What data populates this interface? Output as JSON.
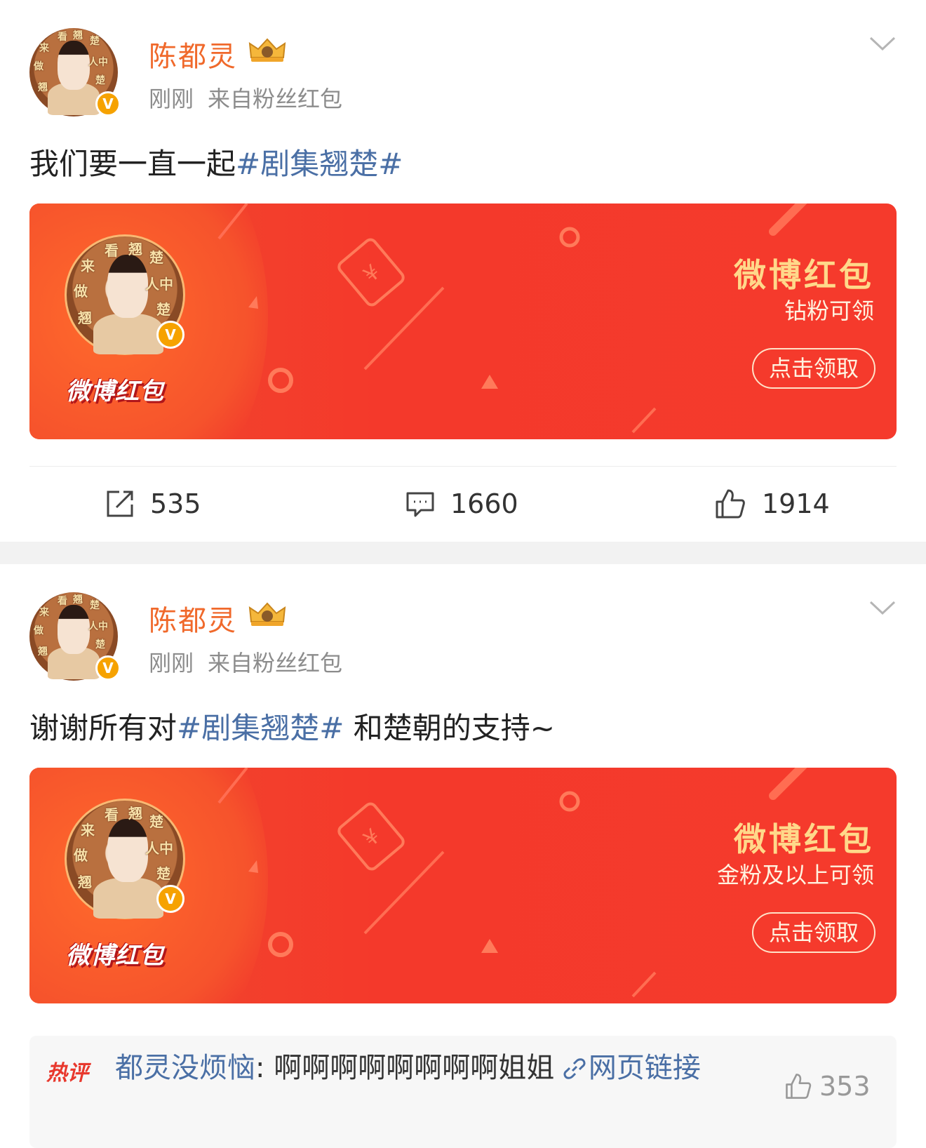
{
  "posts": [
    {
      "author": "陈都灵",
      "time": "刚刚",
      "source": "来自粉丝红包",
      "text_before": "我们要一直一起",
      "topic": "#剧集翘楚#",
      "text_after": "",
      "redpacket": {
        "logo": "微博红包",
        "title": "微博红包",
        "subtitle": "钻粉可领",
        "button": "点击领取"
      },
      "stats": {
        "reposts": "535",
        "comments": "1660",
        "likes": "1914"
      }
    },
    {
      "author": "陈都灵",
      "time": "刚刚",
      "source": "来自粉丝红包",
      "text_before": "谢谢所有对",
      "topic": "#剧集翘楚#",
      "text_after": " 和楚朝的支持~",
      "redpacket": {
        "logo": "微博红包",
        "title": "微博红包",
        "subtitle": "金粉及以上可领",
        "button": "点击领取"
      },
      "hot_comment": {
        "badge": "热评",
        "user": "都灵没烦恼",
        "text": ": 啊啊啊啊啊啊啊啊姐姐 ",
        "link": "网页链接",
        "likes": "353"
      }
    }
  ],
  "avatar_text": {
    "a": "来",
    "b": "看",
    "c": "翘",
    "d": "楚",
    "e": "人中",
    "f": "做",
    "g": "翘",
    "h": "楚"
  },
  "verified_mark": "V",
  "colors": {
    "username": "#f0692b",
    "topic": "#4a6fa5",
    "redpacket_bg": "#f4392b",
    "redpacket_title": "#ffd88a",
    "hot_badge": "#e8382d"
  },
  "icons": [
    "crown-icon",
    "chevron-down-icon",
    "repost-icon",
    "comment-icon",
    "like-icon",
    "link-icon"
  ]
}
